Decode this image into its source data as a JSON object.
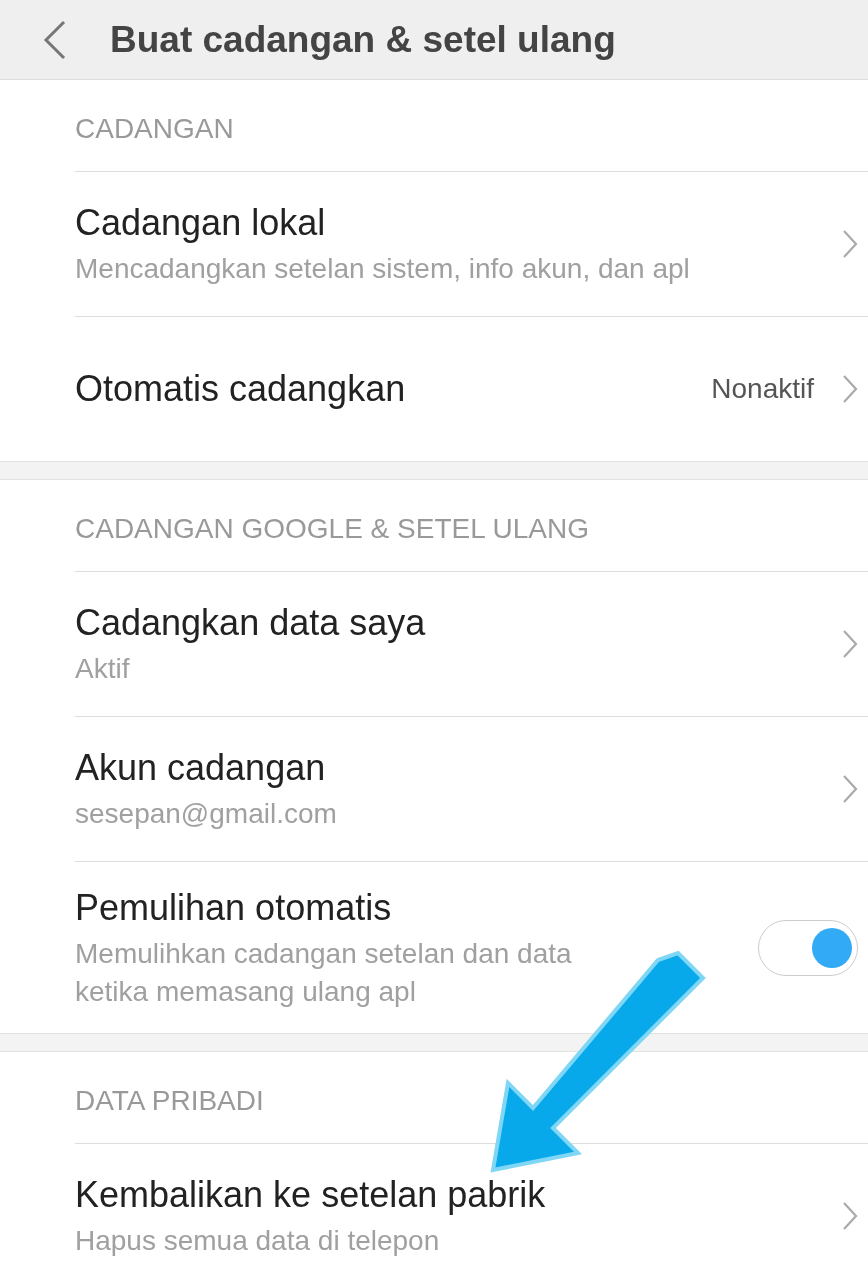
{
  "header": {
    "title": "Buat cadangan & setel ulang"
  },
  "sections": [
    {
      "heading": "CADANGAN",
      "items": [
        {
          "kind": "link",
          "title": "Cadangan lokal",
          "subtitle": "Mencadangkan setelan sistem, info akun, dan apl"
        },
        {
          "kind": "link",
          "title": "Otomatis cadangkan",
          "value": "Nonaktif"
        }
      ]
    },
    {
      "heading": "CADANGAN GOOGLE & SETEL ULANG",
      "items": [
        {
          "kind": "link",
          "title": "Cadangkan data saya",
          "subtitle": "Aktif"
        },
        {
          "kind": "link",
          "title": "Akun cadangan",
          "subtitle": "sesepan@gmail.com"
        },
        {
          "kind": "toggle",
          "title": "Pemulihan otomatis",
          "subtitle": "Memulihkan cadangan setelan dan data ketika memasang ulang apl",
          "on": true
        }
      ]
    },
    {
      "heading": "DATA PRIBADI",
      "items": [
        {
          "kind": "link",
          "title": "Kembalikan ke setelan pabrik",
          "subtitle": "Hapus semua data di telepon"
        }
      ]
    }
  ]
}
